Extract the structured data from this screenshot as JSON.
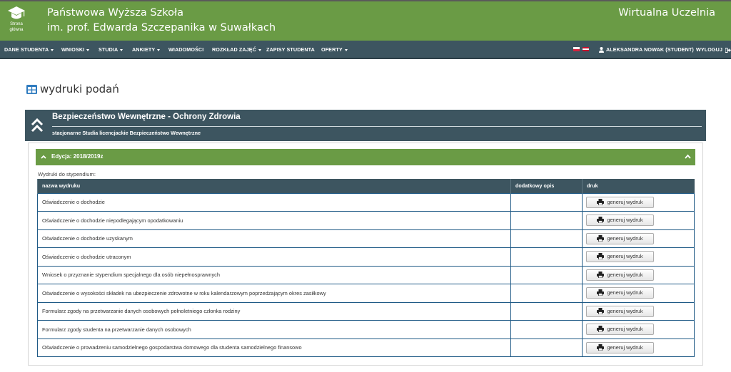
{
  "header": {
    "logo_text_1": "Strona",
    "logo_text_2": "główna",
    "uni_line1": "Państwowa Wyższa Szkoła",
    "uni_line2": "im. prof. Edwarda Szczepanika w Suwałkach",
    "virtual": "Wirtualna Uczelnia"
  },
  "nav": {
    "dane": "DANE STUDENTA",
    "wnioski": "WNIOSKI",
    "studia": "STUDIA",
    "ankiety": "ANKIETY",
    "wiadomosci": "WIADOMOŚCI",
    "rozklad": "ROZKŁAD ZAJĘĆ",
    "zapisy": "ZAPISY STUDENTA",
    "oferty": "OFERTY",
    "user": "ALEKSANDRA NOWAK (STUDENT)",
    "logout": "WYLOGUJ"
  },
  "page": {
    "title": "wydruki podań"
  },
  "program": {
    "title": "Bezpieczeństwo Wewnętrzne - Ochrony Zdrowia",
    "subtitle": "stacjonarne Studia licencjackie Bezpieczeństwo Wewnętrzne"
  },
  "edition": {
    "label": "Edycja: 2018/2019z"
  },
  "table": {
    "caption": "Wydruki do stypendium:",
    "headers": [
      "nazwa wydruku",
      "dodatkowy opis",
      "druk"
    ],
    "button_label": "generuj wydruk",
    "rows": [
      {
        "name": "Oświadczenie o dochodzie",
        "desc": ""
      },
      {
        "name": "Oświadczenie o dochodzie niepodlegającym opodatkowaniu",
        "desc": ""
      },
      {
        "name": "Oświadczenie o dochodzie uzyskanym",
        "desc": ""
      },
      {
        "name": "Oświadczenie o dochodzie utraconym",
        "desc": ""
      },
      {
        "name": "Wniosek o przyznanie stypendium specjalnego dla osób niepełnosprawnych",
        "desc": ""
      },
      {
        "name": "Oświadczenie o wysokości składek na ubezpieczenie zdrowotne w roku kalendarzowym poprzedzającym okres zasiłkowy",
        "desc": ""
      },
      {
        "name": "Formularz zgody na przetwarzanie danych osobowych pełnoletniego członka rodziny",
        "desc": ""
      },
      {
        "name": "Formularz zgody studenta na przetwarzanie danych osobowych",
        "desc": ""
      },
      {
        "name": "Oświadczenie o prowadzeniu samodzielnego gospodarstwa domowego dla studenta samodzielnego finansowo",
        "desc": ""
      }
    ]
  },
  "colors": {
    "green": "#6a9b45",
    "slate": "#3d5560",
    "table_border": "#1f5a86"
  }
}
